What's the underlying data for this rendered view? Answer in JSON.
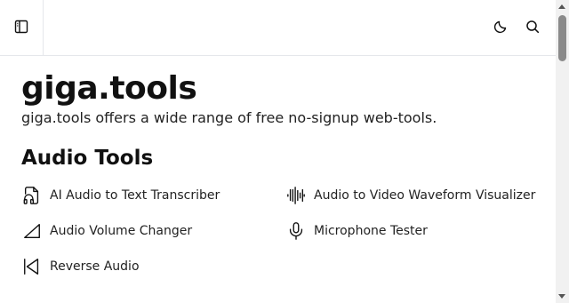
{
  "header": {
    "sidebar_toggle_icon": "sidebar-toggle-icon",
    "theme_icon": "moon-icon",
    "search_icon": "search-icon"
  },
  "main": {
    "title": "giga.tools",
    "description": "giga.tools offers a wide range of free no-signup web-tools.",
    "section_title": "Audio Tools",
    "tools": [
      {
        "label": "AI Audio to Text Transcriber",
        "icon": "audio-file-icon"
      },
      {
        "label": "Audio to Video Waveform Visualizer",
        "icon": "waveform-icon"
      },
      {
        "label": "Audio Volume Changer",
        "icon": "volume-wedge-icon"
      },
      {
        "label": "Microphone Tester",
        "icon": "microphone-icon"
      },
      {
        "label": "Reverse Audio",
        "icon": "reverse-play-icon"
      }
    ]
  },
  "colors": {
    "text": "#111111",
    "border": "#e5e7eb",
    "background": "#ffffff"
  }
}
